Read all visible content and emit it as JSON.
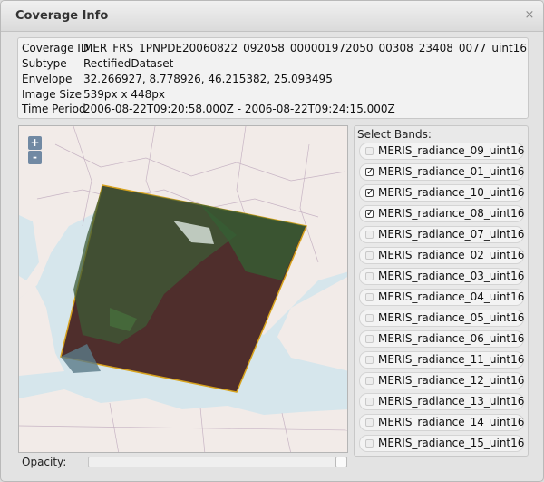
{
  "dialog": {
    "title": "Coverage Info",
    "close_symbol": "×"
  },
  "coverage": {
    "rows": [
      {
        "key": "Coverage ID",
        "value": "MER_FRS_1PNPDE20060822_092058_000001972050_00308_23408_0077_uint16_"
      },
      {
        "key": "Subtype",
        "value": "RectifiedDataset"
      },
      {
        "key": "Envelope",
        "value": "32.266927, 8.778926, 46.215382, 25.093495"
      },
      {
        "key": "Image Size",
        "value": "539px x 448px"
      },
      {
        "key": "Time Period",
        "value": "2006-08-22T09:20:58.000Z - 2006-08-22T09:24:15.000Z"
      }
    ]
  },
  "map": {
    "zoom_in": "+",
    "zoom_out": "-",
    "opacity_label": "Opacity:",
    "opacity_value": 1.0,
    "colors": {
      "land": "#f2ebe8",
      "sea": "#d6e6ec",
      "overlay_border": "#d7a21d"
    }
  },
  "bands": {
    "title": "Select Bands:",
    "items": [
      {
        "label": "MERIS_radiance_09_uint16",
        "checked": false
      },
      {
        "label": "MERIS_radiance_01_uint16",
        "checked": true
      },
      {
        "label": "MERIS_radiance_10_uint16",
        "checked": true
      },
      {
        "label": "MERIS_radiance_08_uint16",
        "checked": true
      },
      {
        "label": "MERIS_radiance_07_uint16",
        "checked": false
      },
      {
        "label": "MERIS_radiance_02_uint16",
        "checked": false
      },
      {
        "label": "MERIS_radiance_03_uint16",
        "checked": false
      },
      {
        "label": "MERIS_radiance_04_uint16",
        "checked": false
      },
      {
        "label": "MERIS_radiance_05_uint16",
        "checked": false
      },
      {
        "label": "MERIS_radiance_06_uint16",
        "checked": false
      },
      {
        "label": "MERIS_radiance_11_uint16",
        "checked": false
      },
      {
        "label": "MERIS_radiance_12_uint16",
        "checked": false
      },
      {
        "label": "MERIS_radiance_13_uint16",
        "checked": false
      },
      {
        "label": "MERIS_radiance_14_uint16",
        "checked": false
      },
      {
        "label": "MERIS_radiance_15_uint16",
        "checked": false
      }
    ]
  }
}
